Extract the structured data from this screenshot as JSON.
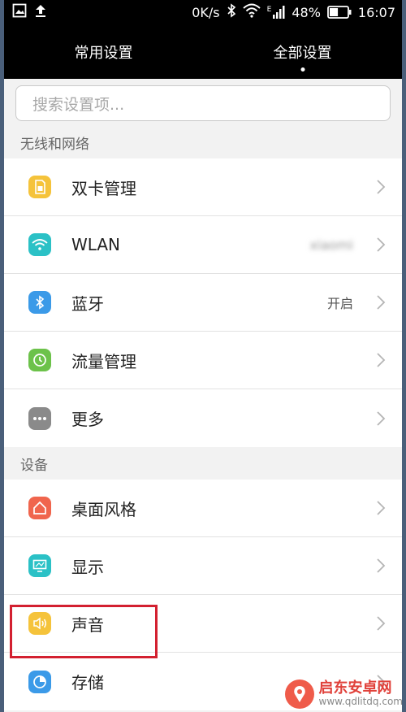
{
  "status_bar": {
    "network_speed": "0K/s",
    "battery": "48%",
    "time": "16:07",
    "signal_type": "E",
    "icons": [
      "gallery-icon",
      "upload-icon",
      "bluetooth-icon",
      "wifi-icon",
      "signal-icon",
      "battery-icon"
    ],
    "battery_level": 0.48
  },
  "tabs": [
    {
      "label": "常用设置",
      "active": false
    },
    {
      "label": "全部设置",
      "active": true
    }
  ],
  "search": {
    "placeholder": "搜索设置项..."
  },
  "sections": [
    {
      "title": "无线和网络",
      "items": [
        {
          "label": "双卡管理",
          "value": "",
          "icon": "sim-card-icon",
          "color": "#f5c33b"
        },
        {
          "label": "WLAN",
          "value": "xiaomi",
          "icon": "wifi-icon",
          "color": "#2bc1c6",
          "value_blurred": true
        },
        {
          "label": "蓝牙",
          "value": "开启",
          "icon": "bluetooth-icon",
          "color": "#3b9ae8"
        },
        {
          "label": "流量管理",
          "value": "",
          "icon": "data-usage-icon",
          "color": "#6cc24a"
        },
        {
          "label": "更多",
          "value": "",
          "icon": "more-icon",
          "color": "#8a8a8a"
        }
      ]
    },
    {
      "title": "设备",
      "items": [
        {
          "label": "桌面风格",
          "value": "",
          "icon": "home-icon",
          "color": "#f0654d"
        },
        {
          "label": "显示",
          "value": "",
          "icon": "display-icon",
          "color": "#2bc1c6"
        },
        {
          "label": "声音",
          "value": "",
          "icon": "sound-icon",
          "color": "#f5c33b"
        },
        {
          "label": "存储",
          "value": "",
          "icon": "storage-icon",
          "color": "#3b9ae8"
        }
      ]
    }
  ],
  "watermark": {
    "title": "启东安卓网",
    "url": "www.qdlitdq.com"
  }
}
